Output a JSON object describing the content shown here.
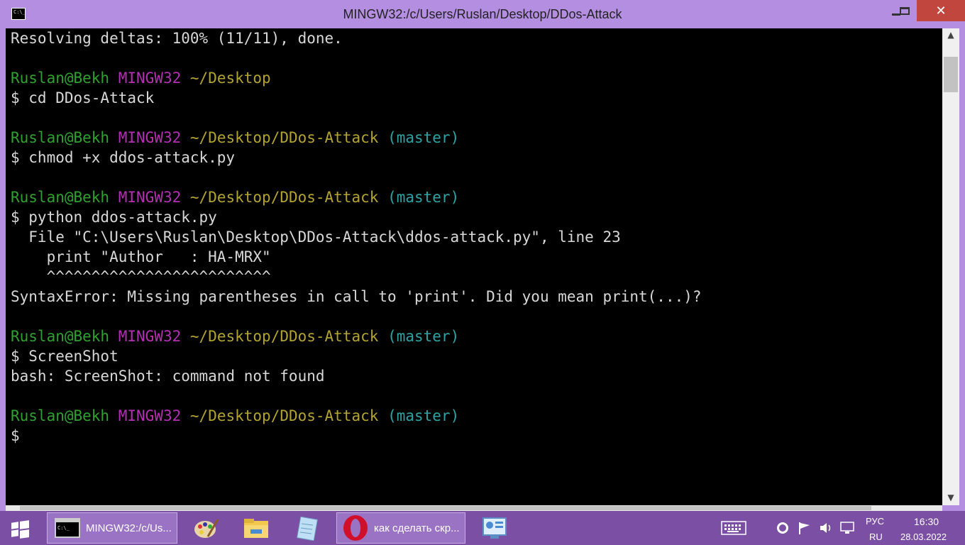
{
  "window": {
    "title": "MINGW32:/c/Users/Ruslan/Desktop/DDos-Attack",
    "icon_text": "C:\\_",
    "close_label": "✕"
  },
  "terminal": {
    "line0": "Resolving deltas: 100% (11/11), done.",
    "prompt1": {
      "user": "Ruslan@Bekh",
      "host": "MINGW32",
      "path": "~/Desktop",
      "branch": ""
    },
    "cmd1": "$ cd DDos-Attack",
    "prompt2": {
      "user": "Ruslan@Bekh",
      "host": "MINGW32",
      "path": "~/Desktop/DDos-Attack",
      "branch": "(master)"
    },
    "cmd2": "$ chmod +x ddos-attack.py",
    "prompt3": {
      "user": "Ruslan@Bekh",
      "host": "MINGW32",
      "path": "~/Desktop/DDos-Attack",
      "branch": "(master)"
    },
    "cmd3": "$ python ddos-attack.py",
    "out3a": "  File \"C:\\Users\\Ruslan\\Desktop\\DDos-Attack\\ddos-attack.py\", line 23",
    "out3b": "    print \"Author   : HA-MRX\"",
    "out3c": "    ^^^^^^^^^^^^^^^^^^^^^^^^^",
    "out3d": "SyntaxError: Missing parentheses in call to 'print'. Did you mean print(...)?",
    "prompt4": {
      "user": "Ruslan@Bekh",
      "host": "MINGW32",
      "path": "~/Desktop/DDos-Attack",
      "branch": "(master)"
    },
    "cmd4": "$ ScreenShot",
    "out4": "bash: ScreenShot: command not found",
    "prompt5": {
      "user": "Ruslan@Bekh",
      "host": "MINGW32",
      "path": "~/Desktop/DDos-Attack",
      "branch": "(master)"
    },
    "cursor": "$"
  },
  "colors": {
    "user": "#2fa12f",
    "host": "#b32fb3",
    "path": "#b3a32f",
    "branch": "#2fa3a3",
    "taskbar": "#7b4fa3",
    "close_button": "#c0463e"
  },
  "taskbar": {
    "tasks": [
      {
        "label": "MINGW32:/c/Us...",
        "icon": "terminal-icon"
      },
      {
        "label": "",
        "icon": "paint-icon"
      },
      {
        "label": "",
        "icon": "folder-icon"
      },
      {
        "label": "",
        "icon": "notepad-icon"
      },
      {
        "label": "как сделать скр...",
        "icon": "opera-icon"
      },
      {
        "label": "",
        "icon": "control-panel-icon"
      }
    ],
    "lang_top": "РУС",
    "lang_bottom": "RU",
    "time": "16:30",
    "date": "28.03.2022"
  }
}
